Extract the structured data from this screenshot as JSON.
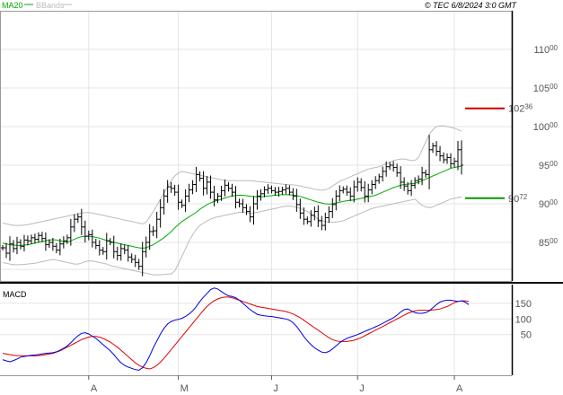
{
  "header": {
    "legend": [
      {
        "label": "MA20",
        "color": "#00aa00"
      },
      {
        "label": "BBands",
        "color": "#bbbbbb"
      }
    ],
    "copyright": "© TEC 6/8/2024 3:0 GMT"
  },
  "colors": {
    "price": "#000000",
    "ma20": "#00aa00",
    "bbands": "#bbbbbb",
    "resistance": "#cc0000",
    "support": "#009900",
    "macd": "#0000dd",
    "signal": "#dd0000",
    "grid": "#e4e4e4",
    "frame": "#000000"
  },
  "chart_data": [
    {
      "type": "line",
      "title": "",
      "price_axis": {
        "ylim": [
          8000,
          11500
        ],
        "ticks": [
          {
            "value": 11000,
            "main": "110",
            "sup": "00"
          },
          {
            "value": 10500,
            "main": "105",
            "sup": "00"
          },
          {
            "value": 10000,
            "main": "100",
            "sup": "00"
          },
          {
            "value": 9500,
            "main": "95",
            "sup": "00"
          },
          {
            "value": 9000,
            "main": "90",
            "sup": "00"
          },
          {
            "value": 8500,
            "main": "85",
            "sup": "00"
          }
        ]
      },
      "levels": [
        {
          "name": "resistance",
          "value": 10236,
          "main": "102",
          "sup": "36"
        },
        {
          "name": "support",
          "value": 9072,
          "main": "90",
          "sup": "72"
        }
      ],
      "x_labels": [
        {
          "label": "A",
          "index": 24
        },
        {
          "label": "M",
          "index": 49
        },
        {
          "label": "J",
          "index": 75
        },
        {
          "label": "J",
          "index": 99
        },
        {
          "label": "A",
          "index": 126
        }
      ],
      "close": [
        8430,
        8360,
        8480,
        8420,
        8500,
        8450,
        8530,
        8520,
        8560,
        8540,
        8590,
        8550,
        8470,
        8500,
        8450,
        8400,
        8480,
        8520,
        8560,
        8700,
        8800,
        8830,
        8700,
        8580,
        8600,
        8500,
        8460,
        8400,
        8380,
        8520,
        8500,
        8380,
        8330,
        8420,
        8400,
        8310,
        8280,
        8240,
        8190,
        8380,
        8500,
        8640,
        8650,
        8800,
        8950,
        9100,
        9220,
        9200,
        9150,
        9020,
        8980,
        9100,
        9180,
        9250,
        9380,
        9330,
        9200,
        9280,
        9150,
        9050,
        9100,
        9170,
        9240,
        9200,
        9150,
        9020,
        9000,
        8950,
        8900,
        8830,
        9000,
        9100,
        9130,
        9180,
        9200,
        9170,
        9150,
        9160,
        9180,
        9200,
        9150,
        9100,
        8990,
        8880,
        8800,
        8770,
        8850,
        8900,
        8780,
        8720,
        8820,
        8900,
        8990,
        9100,
        9170,
        9190,
        9150,
        9100,
        9220,
        9280,
        9210,
        9100,
        9180,
        9250,
        9300,
        9350,
        9420,
        9480,
        9500,
        9470,
        9400,
        9280,
        9230,
        9170,
        9240,
        9300,
        9320,
        9400,
        9380,
        9700,
        9750,
        9680,
        9620,
        9570,
        9600,
        9520,
        9550,
        9700,
        9500
      ],
      "ma20": [
        8490,
        8480,
        8470,
        8465,
        8460,
        8460,
        8465,
        8470,
        8480,
        8490,
        8500,
        8510,
        8520,
        8530,
        8535,
        8530,
        8520,
        8510,
        8505,
        8520,
        8540,
        8560,
        8575,
        8580,
        8580,
        8575,
        8565,
        8555,
        8540,
        8525,
        8510,
        8500,
        8490,
        8480,
        8470,
        8460,
        8450,
        8440,
        8430,
        8425,
        8430,
        8450,
        8470,
        8500,
        8530,
        8560,
        8600,
        8640,
        8690,
        8730,
        8770,
        8800,
        8830,
        8860,
        8890,
        8930,
        8960,
        8990,
        9010,
        9030,
        9045,
        9060,
        9075,
        9090,
        9100,
        9108,
        9112,
        9110,
        9105,
        9098,
        9094,
        9090,
        9090,
        9095,
        9100,
        9105,
        9110,
        9115,
        9118,
        9120,
        9118,
        9112,
        9105,
        9095,
        9080,
        9065,
        9050,
        9035,
        9020,
        9010,
        9000,
        8995,
        9000,
        9010,
        9020,
        9030,
        9040,
        9045,
        9050,
        9060,
        9070,
        9080,
        9090,
        9100,
        9110,
        9130,
        9150,
        9170,
        9190,
        9210,
        9225,
        9240,
        9250,
        9255,
        9260,
        9265,
        9280,
        9300,
        9320,
        9340,
        9360,
        9380,
        9400,
        9420,
        9440,
        9460,
        9470,
        9480,
        9490
      ],
      "bb_upper": [
        8750,
        8740,
        8730,
        8720,
        8720,
        8720,
        8725,
        8730,
        8740,
        8750,
        8760,
        8770,
        8780,
        8790,
        8800,
        8810,
        8820,
        8830,
        8840,
        8850,
        8860,
        8870,
        8880,
        8885,
        8885,
        8880,
        8870,
        8860,
        8850,
        8840,
        8830,
        8820,
        8810,
        8800,
        8790,
        8780,
        8770,
        8760,
        8750,
        8740,
        8760,
        8830,
        8900,
        8980,
        9060,
        9140,
        9220,
        9300,
        9360,
        9400,
        9420,
        9410,
        9400,
        9390,
        9380,
        9370,
        9360,
        9350,
        9340,
        9330,
        9320,
        9310,
        9305,
        9300,
        9300,
        9300,
        9300,
        9300,
        9300,
        9300,
        9295,
        9290,
        9285,
        9280,
        9275,
        9270,
        9265,
        9260,
        9255,
        9250,
        9248,
        9245,
        9240,
        9230,
        9220,
        9210,
        9200,
        9190,
        9180,
        9175,
        9180,
        9200,
        9230,
        9260,
        9290,
        9310,
        9330,
        9350,
        9370,
        9390,
        9410,
        9430,
        9450,
        9460,
        9470,
        9480,
        9500,
        9520,
        9540,
        9560,
        9570,
        9580,
        9580,
        9570,
        9560,
        9560,
        9600,
        9700,
        9800,
        9900,
        9960,
        10000,
        10010,
        10010,
        10000,
        9990,
        9980,
        9960,
        9940
      ],
      "bb_lower": [
        8240,
        8230,
        8220,
        8210,
        8210,
        8210,
        8215,
        8220,
        8225,
        8230,
        8240,
        8250,
        8260,
        8270,
        8280,
        8270,
        8260,
        8250,
        8240,
        8230,
        8220,
        8220,
        8230,
        8250,
        8260,
        8260,
        8250,
        8240,
        8230,
        8220,
        8200,
        8190,
        8180,
        8170,
        8160,
        8150,
        8140,
        8130,
        8120,
        8110,
        8100,
        8090,
        8080,
        8080,
        8080,
        8085,
        8090,
        8090,
        8130,
        8220,
        8320,
        8420,
        8520,
        8600,
        8670,
        8720,
        8750,
        8780,
        8800,
        8820,
        8830,
        8840,
        8850,
        8860,
        8870,
        8880,
        8890,
        8890,
        8885,
        8875,
        8880,
        8890,
        8900,
        8910,
        8920,
        8930,
        8940,
        8950,
        8960,
        8970,
        8970,
        8965,
        8955,
        8940,
        8920,
        8900,
        8870,
        8840,
        8800,
        8780,
        8770,
        8760,
        8760,
        8765,
        8770,
        8780,
        8800,
        8820,
        8840,
        8860,
        8880,
        8900,
        8920,
        8940,
        8950,
        8960,
        8970,
        8980,
        8990,
        9000,
        9010,
        9020,
        9030,
        9040,
        9050,
        9060,
        9020,
        8980,
        8960,
        8950,
        8960,
        8980,
        9000,
        9020,
        9040,
        9060,
        9070,
        9080,
        9090
      ]
    },
    {
      "type": "line",
      "title": "MACD",
      "ylim": [
        -80,
        210
      ],
      "ticks": [
        {
          "value": 150,
          "label": "150"
        },
        {
          "value": 100,
          "label": "100"
        },
        {
          "value": 50,
          "label": "50"
        }
      ],
      "macd": [
        -30,
        -34,
        -37,
        -33,
        -28,
        -22,
        -20,
        -18,
        -16,
        -15,
        -14,
        -12,
        -10,
        -9,
        -8,
        -5,
        0,
        6,
        14,
        24,
        36,
        46,
        54,
        56,
        52,
        45,
        38,
        28,
        18,
        8,
        -2,
        -14,
        -28,
        -40,
        -48,
        -54,
        -58,
        -62,
        -64,
        -56,
        -40,
        -18,
        8,
        30,
        52,
        70,
        84,
        92,
        96,
        99,
        102,
        108,
        116,
        126,
        140,
        156,
        170,
        182,
        194,
        199,
        196,
        188,
        180,
        174,
        172,
        168,
        160,
        150,
        140,
        130,
        122,
        115,
        112,
        110,
        109,
        108,
        106,
        104,
        102,
        100,
        96,
        88,
        76,
        60,
        44,
        30,
        18,
        8,
        0,
        -6,
        -8,
        -4,
        4,
        14,
        24,
        32,
        38,
        42,
        46,
        50,
        55,
        60,
        65,
        70,
        75,
        80,
        86,
        92,
        98,
        104,
        112,
        122,
        130,
        132,
        126,
        120,
        118,
        118,
        120,
        126,
        136,
        146,
        154,
        158,
        160,
        160,
        158,
        156,
        158,
        154,
        146
      ],
      "signal": [
        -10,
        -12,
        -14,
        -16,
        -17,
        -17,
        -18,
        -18,
        -18,
        -18,
        -17,
        -16,
        -14,
        -12,
        -10,
        -6,
        -2,
        4,
        10,
        16,
        22,
        28,
        34,
        38,
        42,
        44,
        44,
        42,
        38,
        32,
        26,
        18,
        10,
        0,
        -10,
        -20,
        -30,
        -40,
        -48,
        -54,
        -58,
        -60,
        -56,
        -48,
        -38,
        -26,
        -12,
        2,
        16,
        30,
        44,
        58,
        72,
        86,
        100,
        114,
        128,
        140,
        150,
        158,
        164,
        168,
        170,
        170,
        168,
        164,
        160,
        156,
        152,
        148,
        144,
        140,
        138,
        136,
        134,
        132,
        130,
        128,
        126,
        124,
        120,
        116,
        110,
        104,
        96,
        88,
        80,
        72,
        64,
        56,
        48,
        40,
        34,
        30,
        28,
        28,
        28,
        30,
        32,
        36,
        40,
        46,
        52,
        58,
        64,
        70,
        76,
        82,
        88,
        94,
        100,
        106,
        112,
        118,
        122,
        126,
        128,
        128,
        128,
        128,
        129,
        130,
        132,
        136,
        140,
        146,
        152,
        156,
        158,
        158,
        156
      ],
      "series": []
    }
  ]
}
